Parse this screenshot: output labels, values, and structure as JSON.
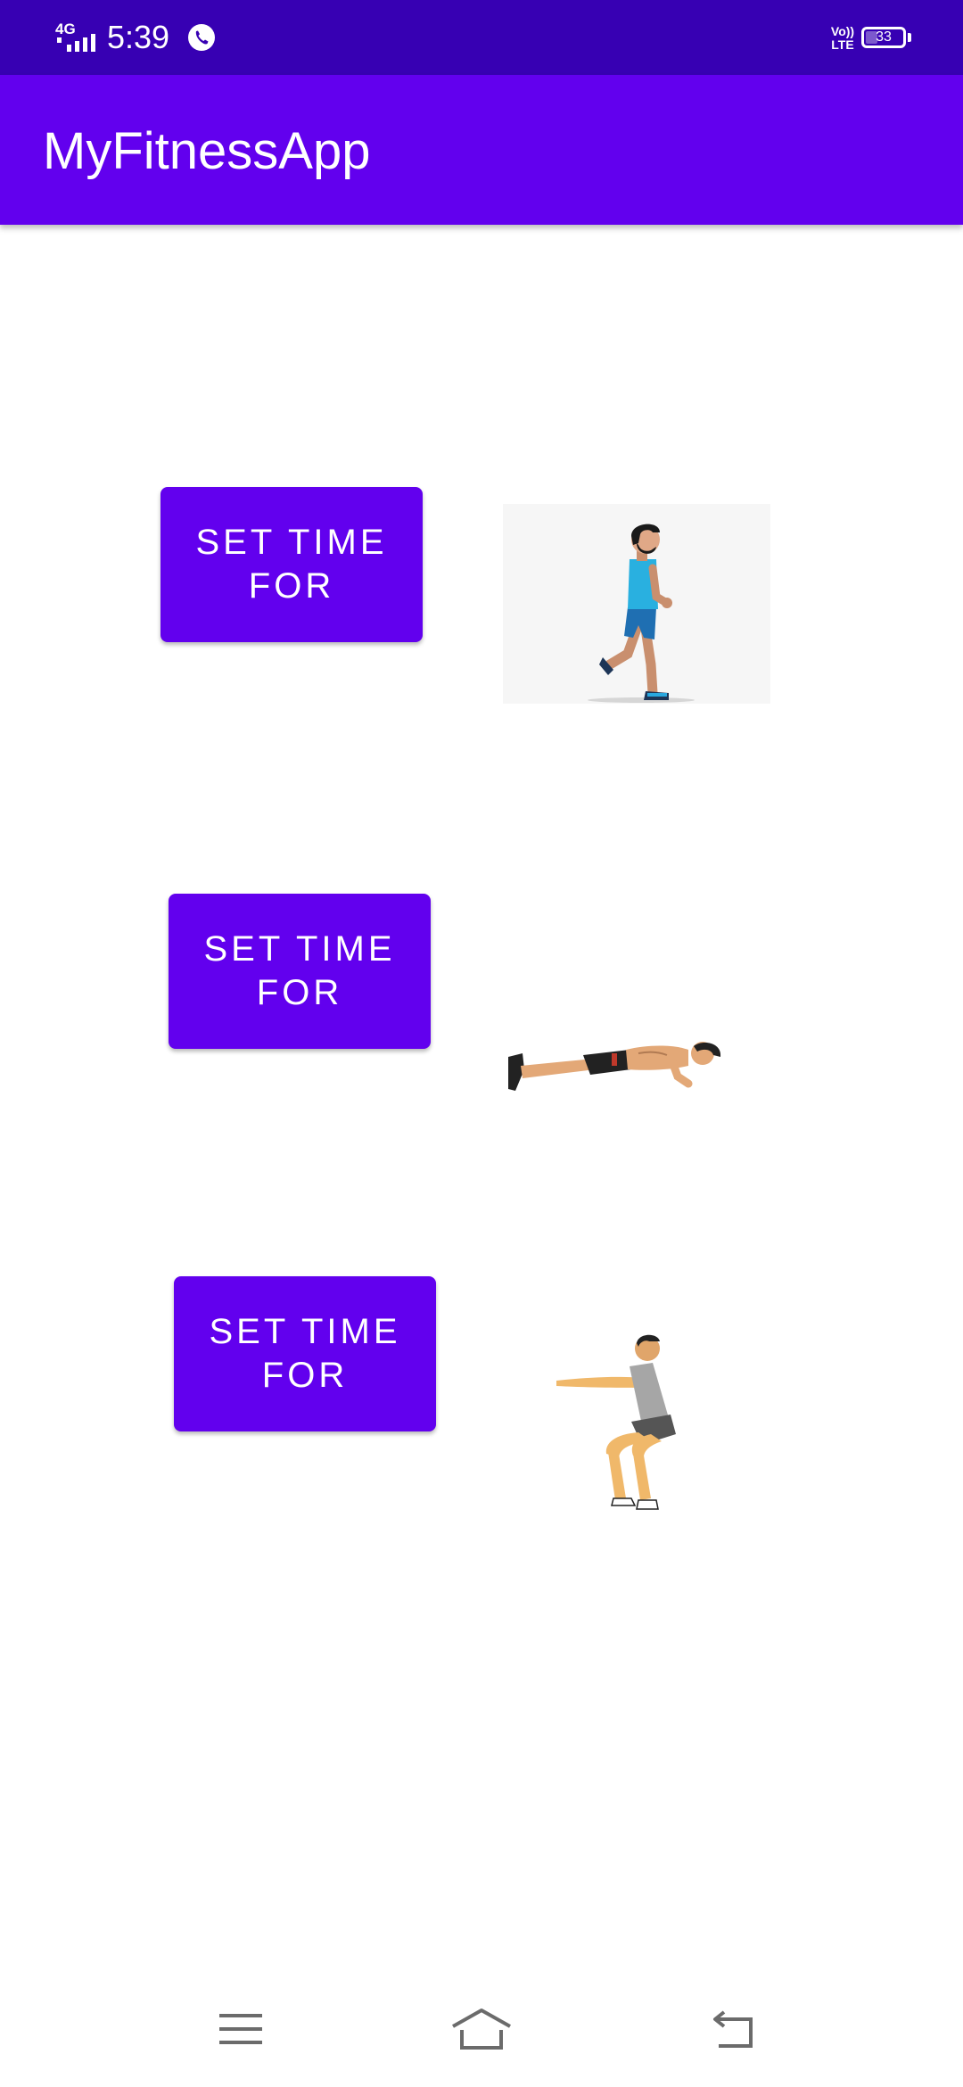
{
  "status_bar": {
    "network": "4G",
    "time": "5:39",
    "volte": "Vo)) LTE",
    "battery": "33",
    "battery_level": 0.33,
    "icons": [
      "signal-icon",
      "phone-call-icon",
      "volte-icon",
      "battery-icon"
    ]
  },
  "app_bar": {
    "title": "MyFitnessApp",
    "color": "#6200ee"
  },
  "exercises": [
    {
      "button_label": "SET TIME FOR",
      "image_icon": "running-man-icon"
    },
    {
      "button_label": "SET TIME FOR",
      "image_icon": "pushup-man-icon"
    },
    {
      "button_label": "SET TIME FOR",
      "image_icon": "squat-man-icon"
    }
  ],
  "nav_bar": {
    "icons": [
      "menu-icon",
      "home-icon",
      "back-icon"
    ]
  },
  "colors": {
    "status_bar": "#3700b3",
    "primary": "#6200ee",
    "background": "#ffffff"
  }
}
